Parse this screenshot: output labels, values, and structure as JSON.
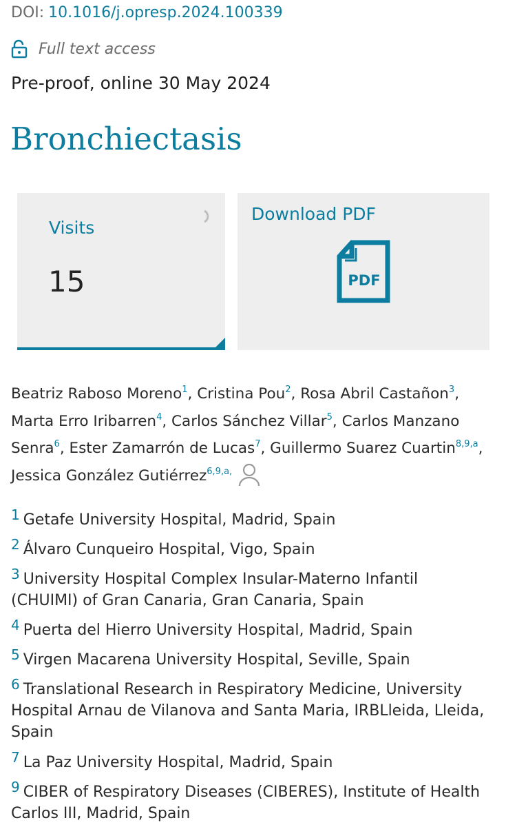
{
  "doi": {
    "label": "DOI:",
    "value": "10.1016/j.opresp.2024.100339"
  },
  "access": {
    "icon": "unlock-icon",
    "text": "Full text access"
  },
  "status": "Pre-proof, online 30 May 2024",
  "title": "Bronchiectasis",
  "metrics": {
    "visits_label": "Visits",
    "visits_value": "15"
  },
  "download": {
    "label": "Download PDF",
    "icon_text": "PDF"
  },
  "authors": [
    {
      "name": "Beatriz Raboso Moreno",
      "sup": "1"
    },
    {
      "name": "Cristina Pou",
      "sup": "2"
    },
    {
      "name": "Rosa Abril Castañon",
      "sup": "3"
    },
    {
      "name": "Marta Erro Iribarren",
      "sup": "4"
    },
    {
      "name": "Carlos Sánchez Villar",
      "sup": "5"
    },
    {
      "name_part1": "Carlos Manzano",
      "name_part2": "Senra",
      "sup": "6"
    },
    {
      "name": "Ester Zamarrón de Lucas",
      "sup": "7"
    },
    {
      "name": "Guillermo Suarez Cuartin",
      "sup": "8,9,a"
    },
    {
      "name": "Jessica González Gutiérrez",
      "sup": "6,9,a,"
    }
  ],
  "affiliations": [
    {
      "num": "1",
      "lines": [
        "Getafe University Hospital, Madrid, Spain"
      ]
    },
    {
      "num": "2",
      "lines": [
        "Álvaro Cunqueiro Hospital, Vigo, Spain"
      ]
    },
    {
      "num": "3",
      "lines": [
        "University Hospital Complex Insular-Materno Infantil",
        "(CHUIMI) of Gran Canaria, Gran Canaria, Spain"
      ]
    },
    {
      "num": "4",
      "lines": [
        "Puerta del Hierro University Hospital, Madrid, Spain"
      ]
    },
    {
      "num": "5",
      "lines": [
        "Virgen Macarena University Hospital, Seville, Spain"
      ]
    },
    {
      "num": "6",
      "lines": [
        "Translational Research in Respiratory Medicine, University",
        "Hospital Arnau de Vilanova and Santa Maria, IRBLleida, Lleida,",
        "Spain"
      ]
    },
    {
      "num": "7",
      "lines": [
        "La Paz University Hospital, Madrid, Spain"
      ]
    },
    {
      "num": "9",
      "lines": [
        "CIBER of Respiratory Diseases (CIBERES), Institute of Health",
        "Carlos III, Madrid, Spain"
      ]
    }
  ]
}
